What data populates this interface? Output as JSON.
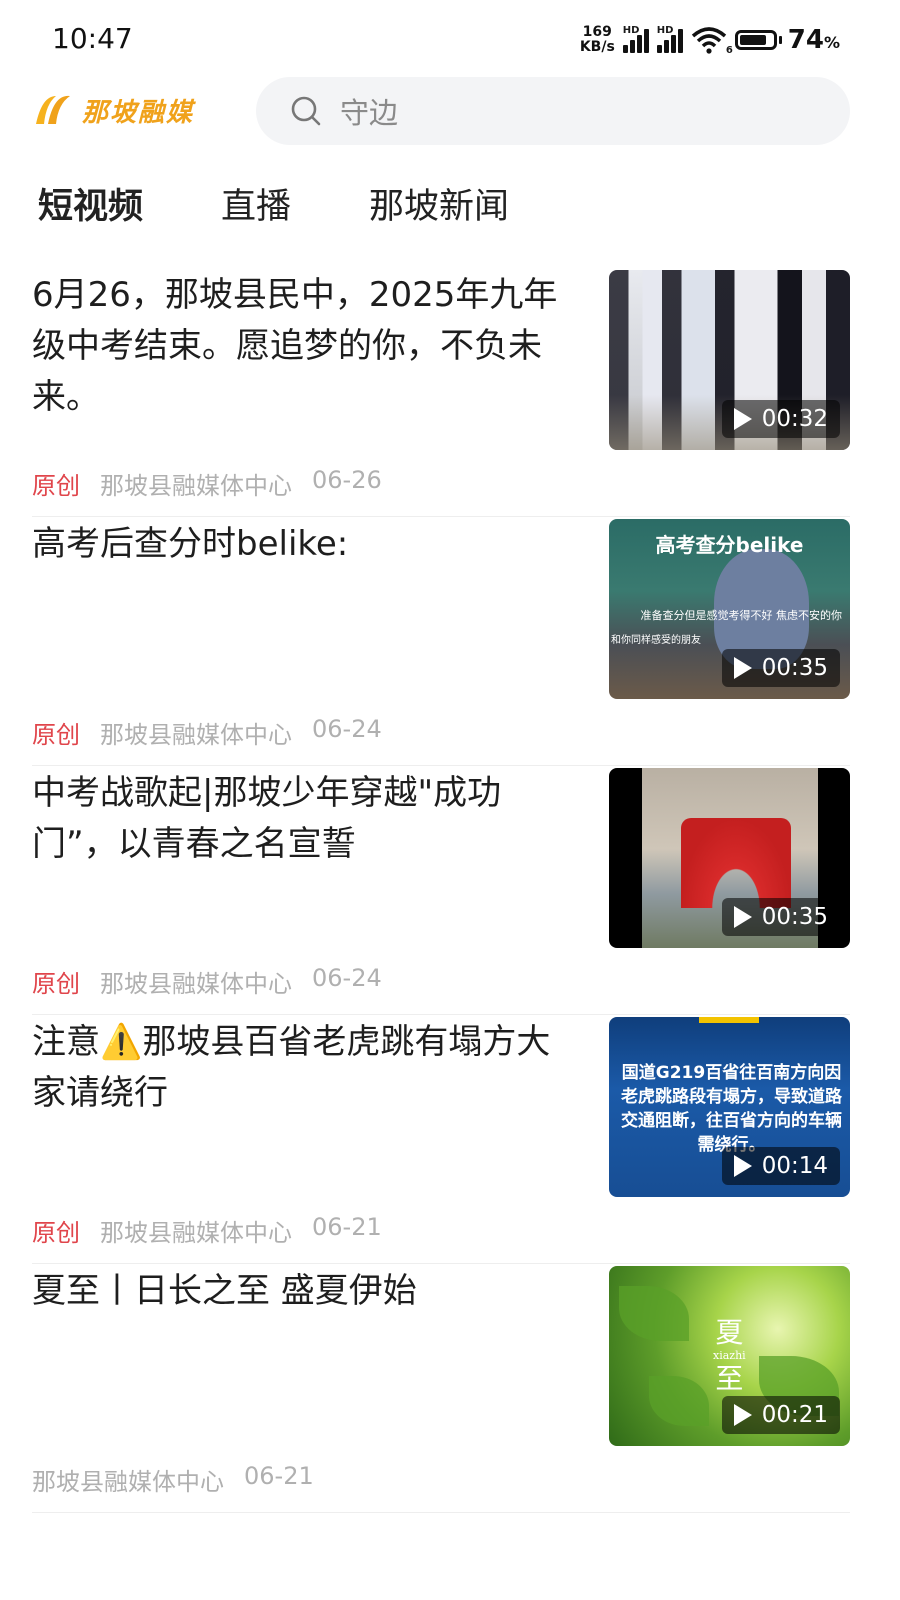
{
  "status_bar": {
    "time": "10:47",
    "net_speed_value": "169",
    "net_speed_unit": "KB/s",
    "signal_label": "HD",
    "wifi_label": "6",
    "battery_percent": "74",
    "battery_unit": "%"
  },
  "header": {
    "logo_text": "那坡融媒",
    "search_placeholder": "守边"
  },
  "tabs": [
    {
      "label": "短视频",
      "active": true
    },
    {
      "label": "直播",
      "active": false
    },
    {
      "label": "那坡新闻",
      "active": false
    }
  ],
  "feed": [
    {
      "title": "6月26，那坡县民中，2025年九年级中考结束。愿追梦的你，不负未来。",
      "tag": "原创",
      "source": "那坡县融媒体中心",
      "date": "06-26",
      "duration": "00:32"
    },
    {
      "title": "高考后查分时belike:",
      "tag": "原创",
      "source": "那坡县融媒体中心",
      "date": "06-24",
      "duration": "00:35",
      "thumb_caption": "高考查分belike",
      "thumb_sub": "准备查分但是感觉考得不好 焦虑不安的你",
      "thumb_sub2": "和你同样感受的朋友"
    },
    {
      "title": "中考战歌起|那坡少年穿越\"成功门”，以青春之名宣誓",
      "tag": "原创",
      "source": "那坡县融媒体中心",
      "date": "06-24",
      "duration": "00:35"
    },
    {
      "title": "注意⚠️那坡县百省老虎跳有塌方大家请绕行",
      "tag": "原创",
      "source": "那坡县融媒体中心",
      "date": "06-21",
      "duration": "00:14",
      "thumb_text": "国道G219百省往百南方向因老虎跳路段有塌方，导致道路交通阻断，往百省方向的车辆需绕行。"
    },
    {
      "title": "夏至丨日长之至 盛夏伊始",
      "tag": "",
      "source": "那坡县融媒体中心",
      "date": "06-21",
      "duration": "00:21",
      "thumb_v1": "夏",
      "thumb_pinyin": "xiazhi",
      "thumb_v2": "至"
    }
  ],
  "colors": {
    "accent": "#f0a21b",
    "tag_red": "#e0454b"
  }
}
